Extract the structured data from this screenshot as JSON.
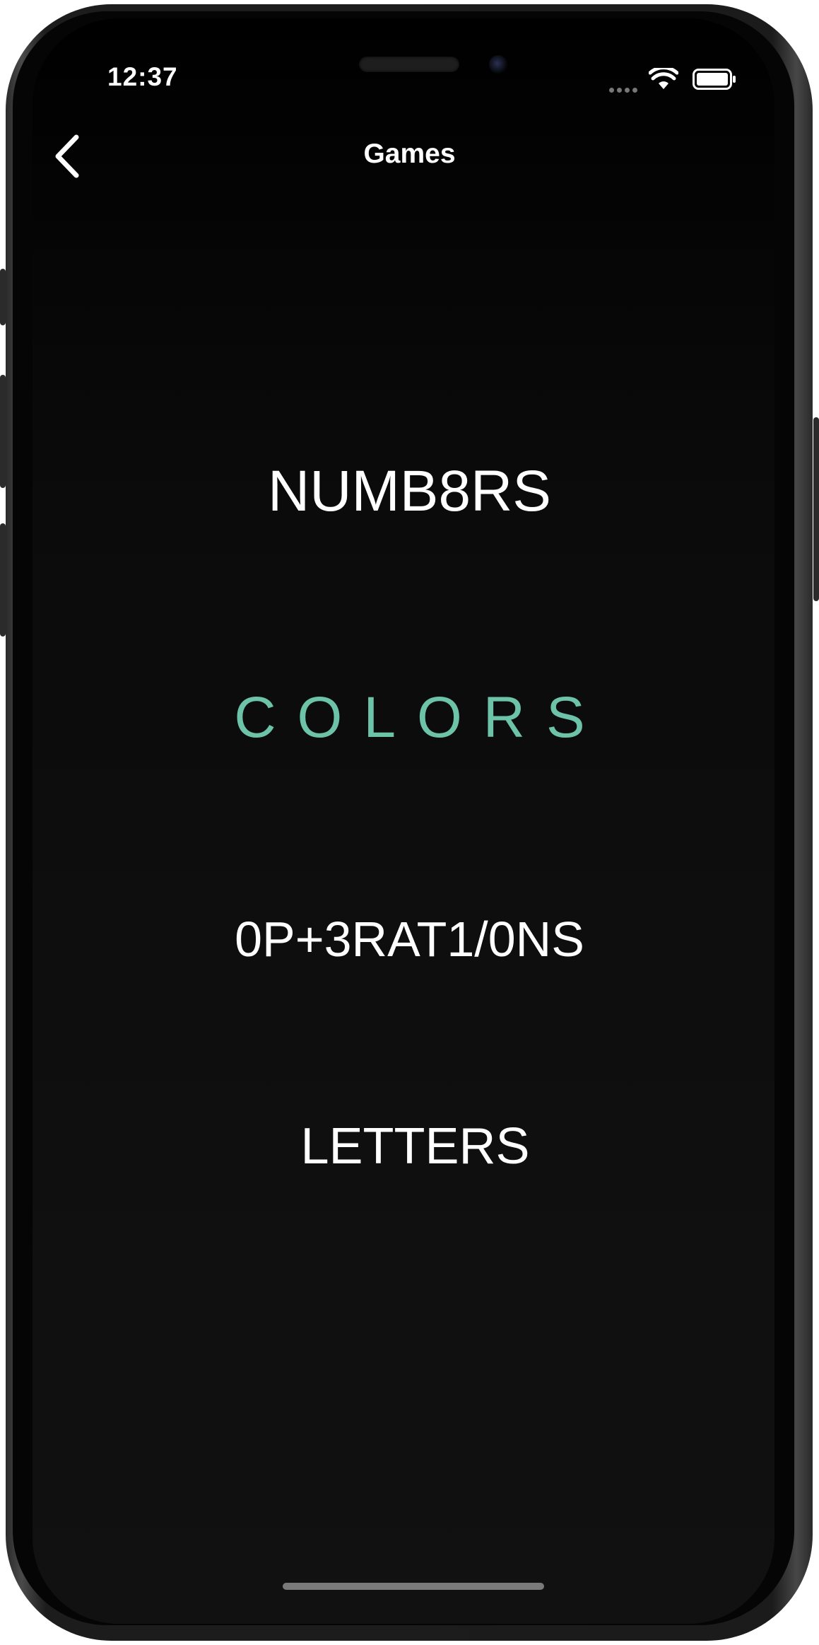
{
  "status_bar": {
    "time": "12:37",
    "wifi_icon": "wifi-icon",
    "battery_icon": "battery-icon"
  },
  "nav": {
    "back_icon": "chevron-left-icon",
    "title": "Games"
  },
  "games": [
    {
      "label": "NUMB8RS"
    },
    {
      "label": "COLORS"
    },
    {
      "label": "0P+3RAT1/0NS"
    },
    {
      "label": "LETTERS"
    }
  ],
  "colors": {
    "background": "#0b0b0b",
    "text": "#ffffff",
    "accent": "#6cc3a8"
  }
}
